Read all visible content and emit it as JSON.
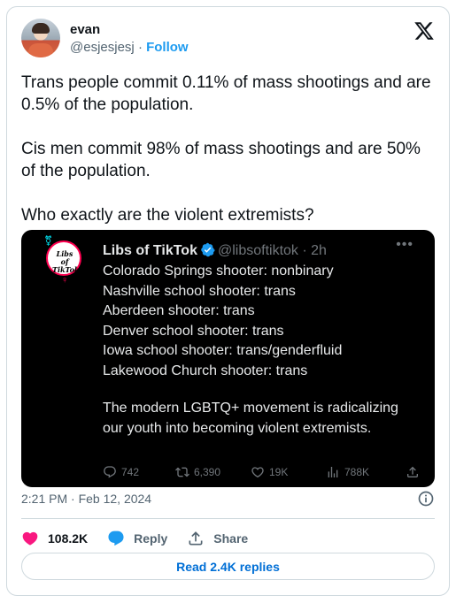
{
  "author": {
    "name": "evan",
    "handle": "@esjesjesj",
    "separator": "·",
    "follow_label": "Follow"
  },
  "tweet": {
    "paragraphs": [
      "Trans people commit 0.11% of mass shootings and are 0.5% of the population.",
      "Cis men commit 98% of mass shootings and are 50% of the population.",
      "Who exactly are the violent extremists?"
    ]
  },
  "quoted": {
    "name": "Libs of TikTok",
    "handle": "@libsoftiktok",
    "time": "· 2h",
    "avatar_text": "Libs of TikTok",
    "lines": [
      "Colorado Springs shooter: nonbinary",
      "Nashville school shooter: trans",
      "Aberdeen shooter: trans",
      "Denver school shooter: trans",
      "Iowa school shooter: trans/genderfluid",
      "Lakewood Church shooter: trans"
    ],
    "paragraph": "The modern LGBTQ+ movement is radicalizing our youth into becoming violent extremists.",
    "stats": {
      "replies": "742",
      "reposts": "6,390",
      "likes": "19K",
      "views": "788K"
    }
  },
  "timestamp": "2:21 PM · Feb 12, 2024",
  "actions": {
    "likes": "108.2K",
    "reply_label": "Reply",
    "share_label": "Share"
  },
  "read_replies_label": "Read 2.4K replies",
  "colors": {
    "accent": "#1d9bf0",
    "like": "#f91880",
    "link": "#006fd6"
  }
}
